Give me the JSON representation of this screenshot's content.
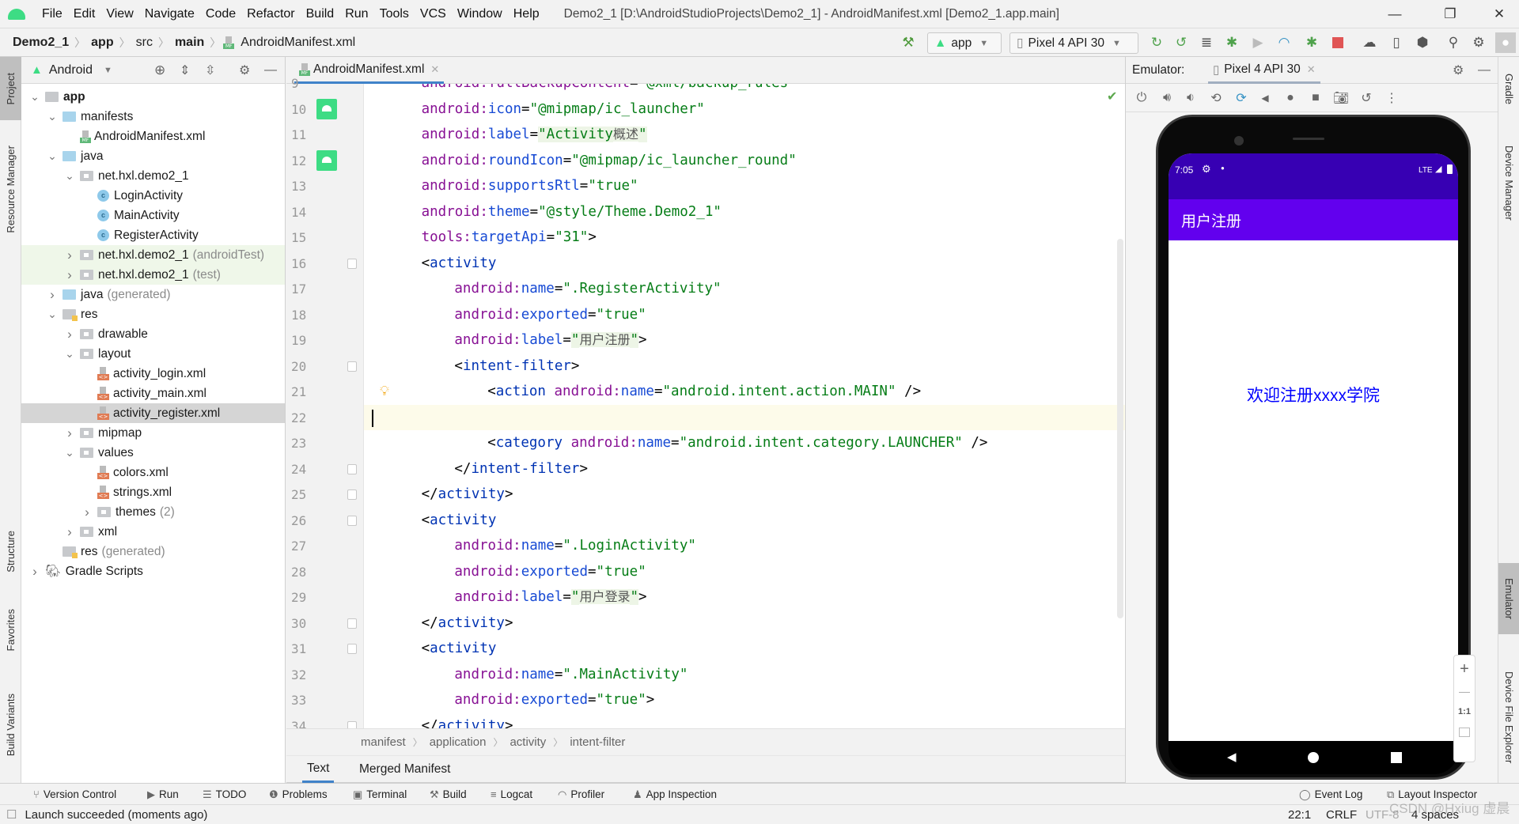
{
  "menubar": {
    "items": [
      "File",
      "Edit",
      "View",
      "Navigate",
      "Code",
      "Refactor",
      "Build",
      "Run",
      "Tools",
      "VCS",
      "Window",
      "Help"
    ],
    "window_title": "Demo2_1 [D:\\AndroidStudioProjects\\Demo2_1] - AndroidManifest.xml [Demo2_1.app.main]",
    "controls": {
      "minimize": "—",
      "maximize": "❐",
      "close": "✕"
    }
  },
  "navbar": {
    "breadcrumb": [
      "Demo2_1",
      "app",
      "src",
      "main",
      "AndroidManifest.xml"
    ],
    "run_config": "app",
    "device": "Pixel 4 API 30",
    "icons": [
      "hammer-icon",
      "apply-changes-restart-icon",
      "apply-code-changes-icon",
      "sync-icon",
      "debug-icon",
      "attach-coverage-icon",
      "profile-icon",
      "attach-debugger-icon",
      "stop-icon",
      "avd-manager-icon",
      "device-manager-icon",
      "sdk-manager-icon",
      "search-icon",
      "settings-icon",
      "avatar-icon"
    ]
  },
  "left_stripe": {
    "tabs": [
      "Project",
      "Resource Manager",
      "Structure",
      "Favorites",
      "Build Variants"
    ]
  },
  "project_panel": {
    "view": "Android",
    "tree": [
      {
        "label": "app",
        "bold": true,
        "level": 0,
        "expanded": true,
        "type": "module"
      },
      {
        "label": "manifests",
        "level": 1,
        "expanded": true,
        "type": "folder"
      },
      {
        "label": "AndroidManifest.xml",
        "level": 2,
        "type": "manifest"
      },
      {
        "label": "java",
        "level": 1,
        "expanded": true,
        "type": "folder"
      },
      {
        "label": "net.hxl.demo2_1",
        "level": 2,
        "expanded": true,
        "type": "package"
      },
      {
        "label": "LoginActivity",
        "level": 3,
        "type": "class"
      },
      {
        "label": "MainActivity",
        "level": 3,
        "type": "class"
      },
      {
        "label": "RegisterActivity",
        "level": 3,
        "type": "class"
      },
      {
        "label": "net.hxl.demo2_1",
        "suffix": "(androidTest)",
        "level": 2,
        "expanded": false,
        "type": "package",
        "green": true
      },
      {
        "label": "net.hxl.demo2_1",
        "suffix": "(test)",
        "level": 2,
        "expanded": false,
        "type": "package",
        "green": true
      },
      {
        "label": "java",
        "suffix": "(generated)",
        "level": 1,
        "expanded": false,
        "type": "folder"
      },
      {
        "label": "res",
        "level": 1,
        "expanded": true,
        "type": "res"
      },
      {
        "label": "drawable",
        "level": 2,
        "expanded": false,
        "type": "package"
      },
      {
        "label": "layout",
        "level": 2,
        "expanded": true,
        "type": "package"
      },
      {
        "label": "activity_login.xml",
        "level": 3,
        "type": "xml"
      },
      {
        "label": "activity_main.xml",
        "level": 3,
        "type": "xml"
      },
      {
        "label": "activity_register.xml",
        "level": 3,
        "type": "xml",
        "selected": true
      },
      {
        "label": "mipmap",
        "level": 2,
        "expanded": false,
        "type": "package"
      },
      {
        "label": "values",
        "level": 2,
        "expanded": true,
        "type": "package"
      },
      {
        "label": "colors.xml",
        "level": 3,
        "type": "xml"
      },
      {
        "label": "strings.xml",
        "level": 3,
        "type": "xml"
      },
      {
        "label": "themes",
        "suffix": "(2)",
        "level": 3,
        "expanded": false,
        "type": "package"
      },
      {
        "label": "xml",
        "level": 2,
        "expanded": false,
        "type": "package"
      },
      {
        "label": "res",
        "suffix": "(generated)",
        "level": 1,
        "type": "res"
      },
      {
        "label": "Gradle Scripts",
        "level": 0,
        "expanded": false,
        "type": "gradle"
      }
    ]
  },
  "editor": {
    "tab": "AndroidManifest.xml",
    "cursor_line": 22,
    "lines": [
      {
        "n": 9,
        "partial": true,
        "indent": 2,
        "tokens": [
          [
            "attr",
            "android:fullBackupContent"
          ],
          [
            "pun",
            "="
          ],
          [
            "str",
            "\"@xml/backup_rules\""
          ]
        ]
      },
      {
        "n": 10,
        "indent": 2,
        "gutter": "android",
        "tokens": [
          [
            "attr",
            "android:"
          ],
          [
            "attr2",
            "icon"
          ],
          [
            "pun",
            "="
          ],
          [
            "str",
            "\"@mipmap/ic_launcher\""
          ]
        ]
      },
      {
        "n": 11,
        "indent": 2,
        "tokens": [
          [
            "attr",
            "android:"
          ],
          [
            "attr2",
            "label"
          ],
          [
            "pun",
            "="
          ],
          [
            "hl",
            "\"Activity"
          ],
          [
            "hlcjk",
            "概述"
          ],
          [
            "hl",
            "\""
          ]
        ]
      },
      {
        "n": 12,
        "indent": 2,
        "gutter": "android",
        "tokens": [
          [
            "attr",
            "android:"
          ],
          [
            "attr2",
            "roundIcon"
          ],
          [
            "pun",
            "="
          ],
          [
            "str",
            "\"@mipmap/ic_launcher_round\""
          ]
        ]
      },
      {
        "n": 13,
        "indent": 2,
        "tokens": [
          [
            "attr",
            "android:"
          ],
          [
            "attr2",
            "supportsRtl"
          ],
          [
            "pun",
            "="
          ],
          [
            "str",
            "\"true\""
          ]
        ]
      },
      {
        "n": 14,
        "indent": 2,
        "tokens": [
          [
            "attr",
            "android:"
          ],
          [
            "attr2",
            "theme"
          ],
          [
            "pun",
            "="
          ],
          [
            "str",
            "\"@style/Theme.Demo2_1\""
          ]
        ]
      },
      {
        "n": 15,
        "indent": 2,
        "tokens": [
          [
            "attr",
            "tools:"
          ],
          [
            "attr2",
            "targetApi"
          ],
          [
            "pun",
            "="
          ],
          [
            "str",
            "\"31\""
          ],
          [
            "pun",
            ">"
          ]
        ]
      },
      {
        "n": 16,
        "indent": 2,
        "fold": true,
        "tokens": [
          [
            "pun",
            "<"
          ],
          [
            "tag",
            "activity"
          ]
        ]
      },
      {
        "n": 17,
        "indent": 3,
        "tokens": [
          [
            "attr",
            "android:"
          ],
          [
            "attr2",
            "name"
          ],
          [
            "pun",
            "="
          ],
          [
            "str",
            "\".RegisterActivity\""
          ]
        ]
      },
      {
        "n": 18,
        "indent": 3,
        "tokens": [
          [
            "attr",
            "android:"
          ],
          [
            "attr2",
            "exported"
          ],
          [
            "pun",
            "="
          ],
          [
            "str",
            "\"true\""
          ]
        ]
      },
      {
        "n": 19,
        "indent": 3,
        "tokens": [
          [
            "attr",
            "android:"
          ],
          [
            "attr2",
            "label"
          ],
          [
            "pun",
            "="
          ],
          [
            "hl",
            "\""
          ],
          [
            "hlcjk",
            "用户注册"
          ],
          [
            "hl",
            "\""
          ],
          [
            "pun",
            ">"
          ]
        ]
      },
      {
        "n": 20,
        "indent": 3,
        "fold": true,
        "tokens": [
          [
            "pun",
            "<"
          ],
          [
            "tag",
            "intent-filter"
          ],
          [
            "pun",
            ">"
          ]
        ]
      },
      {
        "n": 21,
        "indent": 4,
        "bulb": true,
        "tokens": [
          [
            "pun",
            "<"
          ],
          [
            "tag",
            "action "
          ],
          [
            "attr",
            "android:"
          ],
          [
            "attr2",
            "name"
          ],
          [
            "pun",
            "="
          ],
          [
            "str",
            "\"android.intent.action.MAIN\""
          ],
          [
            "pun",
            " />"
          ]
        ]
      },
      {
        "n": 22,
        "indent": 0,
        "current": true,
        "tokens": []
      },
      {
        "n": 23,
        "indent": 4,
        "tokens": [
          [
            "pun",
            "<"
          ],
          [
            "tag",
            "category "
          ],
          [
            "attr",
            "android:"
          ],
          [
            "attr2",
            "name"
          ],
          [
            "pun",
            "="
          ],
          [
            "str",
            "\"android.intent.category.LAUNCHER\""
          ],
          [
            "pun",
            " />"
          ]
        ]
      },
      {
        "n": 24,
        "indent": 3,
        "fold": true,
        "tokens": [
          [
            "pun",
            "</"
          ],
          [
            "tag",
            "intent-filter"
          ],
          [
            "pun",
            ">"
          ]
        ]
      },
      {
        "n": 25,
        "indent": 2,
        "fold": true,
        "tokens": [
          [
            "pun",
            "</"
          ],
          [
            "tag",
            "activity"
          ],
          [
            "pun",
            ">"
          ]
        ]
      },
      {
        "n": 26,
        "indent": 2,
        "fold": true,
        "tokens": [
          [
            "pun",
            "<"
          ],
          [
            "tag",
            "activity"
          ]
        ]
      },
      {
        "n": 27,
        "indent": 3,
        "tokens": [
          [
            "attr",
            "android:"
          ],
          [
            "attr2",
            "name"
          ],
          [
            "pun",
            "="
          ],
          [
            "str",
            "\".LoginActivity\""
          ]
        ]
      },
      {
        "n": 28,
        "indent": 3,
        "tokens": [
          [
            "attr",
            "android:"
          ],
          [
            "attr2",
            "exported"
          ],
          [
            "pun",
            "="
          ],
          [
            "str",
            "\"true\""
          ]
        ]
      },
      {
        "n": 29,
        "indent": 3,
        "tokens": [
          [
            "attr",
            "android:"
          ],
          [
            "attr2",
            "label"
          ],
          [
            "pun",
            "="
          ],
          [
            "hl",
            "\""
          ],
          [
            "hlcjk",
            "用户登录"
          ],
          [
            "hl",
            "\""
          ],
          [
            "pun",
            ">"
          ]
        ]
      },
      {
        "n": 30,
        "indent": 2,
        "fold": true,
        "tokens": [
          [
            "pun",
            "</"
          ],
          [
            "tag",
            "activity"
          ],
          [
            "pun",
            ">"
          ]
        ]
      },
      {
        "n": 31,
        "indent": 2,
        "fold": true,
        "tokens": [
          [
            "pun",
            "<"
          ],
          [
            "tag",
            "activity"
          ]
        ]
      },
      {
        "n": 32,
        "indent": 3,
        "tokens": [
          [
            "attr",
            "android:"
          ],
          [
            "attr2",
            "name"
          ],
          [
            "pun",
            "="
          ],
          [
            "str",
            "\".MainActivity\""
          ]
        ]
      },
      {
        "n": 33,
        "indent": 3,
        "tokens": [
          [
            "attr",
            "android:"
          ],
          [
            "attr2",
            "exported"
          ],
          [
            "pun",
            "="
          ],
          [
            "str",
            "\"true\""
          ],
          [
            "pun",
            ">"
          ]
        ]
      },
      {
        "n": 34,
        "indent": 2,
        "fold": true,
        "tokens": [
          [
            "pun",
            "</"
          ],
          [
            "tag",
            "activity"
          ],
          [
            "pun",
            ">"
          ]
        ]
      }
    ],
    "breadcrumb": [
      "manifest",
      "application",
      "activity",
      "intent-filter"
    ],
    "bottom_tabs": [
      "Text",
      "Merged Manifest"
    ],
    "active_bottom_tab": "Text"
  },
  "emulator": {
    "label": "Emulator:",
    "tab": "Pixel 4 API 30",
    "controls": [
      "power-icon",
      "volume-up-icon",
      "volume-down-icon",
      "rotate-left-icon",
      "rotate-right-icon",
      "back-icon",
      "home-icon",
      "overview-icon",
      "screenshot-icon",
      "snapshot-icon",
      "more-icon"
    ],
    "phone": {
      "time": "7:05",
      "network": "LTE",
      "app_title": "用户注册",
      "content_text": "欢迎注册xxxx学院",
      "colors": {
        "status_bar": "#3700b3",
        "app_bar": "#6200ee",
        "content_text": "#0000ff"
      }
    },
    "zoom_controls": [
      "+",
      "—",
      "1:1"
    ]
  },
  "right_stripe": {
    "tabs": [
      "Gradle",
      "Device Manager",
      "Emulator",
      "Device File Explorer"
    ]
  },
  "bottom_toolbar": {
    "left": [
      "Version Control",
      "Run",
      "TODO",
      "Problems",
      "Terminal",
      "Build",
      "Logcat",
      "Profiler",
      "App Inspection"
    ],
    "right": [
      "Event Log",
      "Layout Inspector"
    ]
  },
  "status_bar": {
    "message": "Launch succeeded (moments ago)",
    "position": "22:1",
    "line_sep": "CRLF",
    "encoding": "UTF-8",
    "indent": "4 spaces",
    "watermark": "CSDN @Hxiug 虚晨"
  }
}
